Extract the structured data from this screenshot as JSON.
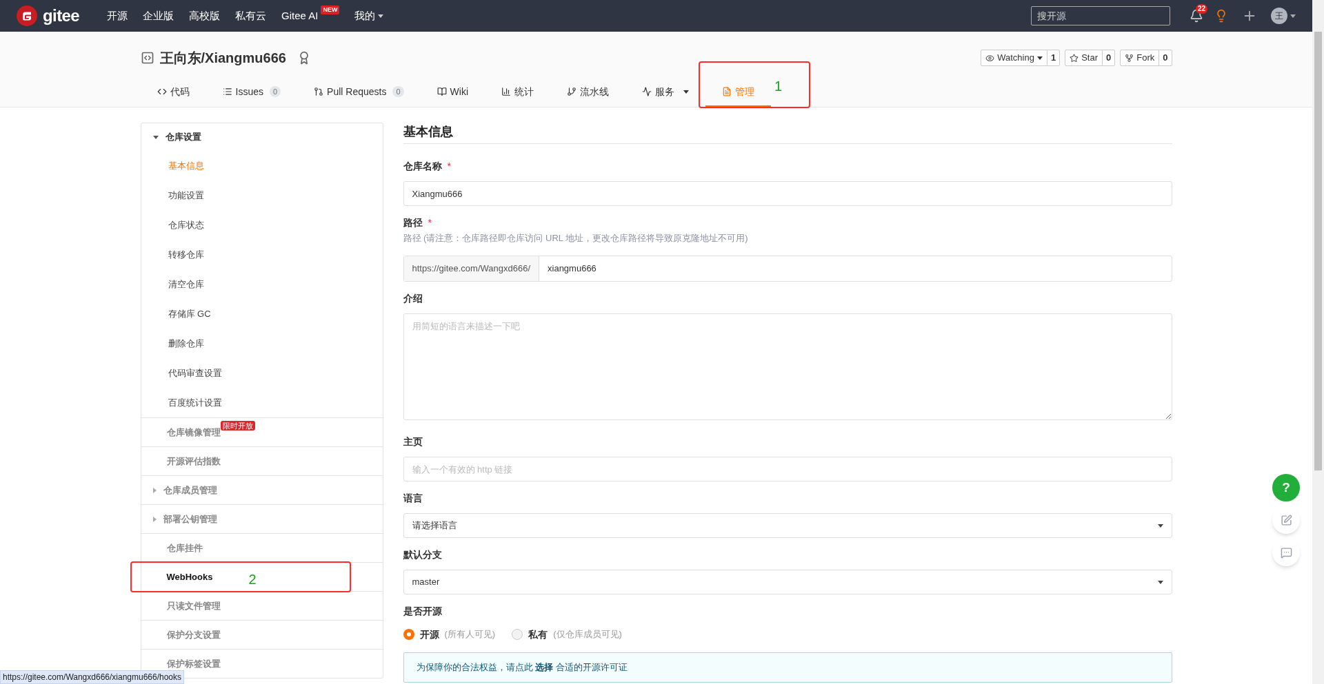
{
  "navbar": {
    "logo_text": "gitee",
    "items": [
      {
        "label": "开源"
      },
      {
        "label": "企业版"
      },
      {
        "label": "高校版"
      },
      {
        "label": "私有云"
      },
      {
        "label": "Gitee AI",
        "badge": "NEW"
      },
      {
        "label": "我的",
        "dropdown": true
      }
    ],
    "search": {
      "placeholder": "搜开源"
    },
    "notification_count": "22",
    "avatar_text": "王"
  },
  "repo": {
    "title": "王向东/Xiangmu666",
    "actions": [
      {
        "label": "Watching",
        "dropdown": true,
        "count": "1"
      },
      {
        "label": "Star",
        "dropdown": false,
        "count": "0"
      },
      {
        "label": "Fork",
        "dropdown": false,
        "count": "0"
      }
    ],
    "tabs": [
      {
        "label": "代码",
        "selected": false
      },
      {
        "label": "Issues",
        "count": "0",
        "selected": false
      },
      {
        "label": "Pull Requests",
        "count": "0",
        "selected": false
      },
      {
        "label": "Wiki",
        "selected": false
      },
      {
        "label": "统计",
        "selected": false
      },
      {
        "label": "流水线",
        "selected": false
      },
      {
        "label": "服务",
        "dropdown": true,
        "selected": false
      },
      {
        "label": "管理",
        "selected": true,
        "annotation": "1"
      }
    ]
  },
  "sidebar": {
    "items": [
      {
        "kind": "group",
        "label": "仓库设置",
        "expanded": true,
        "children": [
          {
            "label": "基本信息",
            "selected": true
          },
          {
            "label": "功能设置",
            "selected": false
          },
          {
            "label": "仓库状态",
            "selected": false
          },
          {
            "label": "转移仓库",
            "selected": false
          },
          {
            "label": "清空仓库",
            "selected": false
          },
          {
            "label": "存储库 GC",
            "selected": false
          },
          {
            "label": "删除仓库",
            "selected": false
          },
          {
            "label": "代码审查设置",
            "selected": false
          },
          {
            "label": "百度统计设置",
            "selected": false
          }
        ]
      },
      {
        "kind": "link",
        "label": "仓库镜像管理",
        "badge": "限时开放",
        "hovered": false
      },
      {
        "kind": "link",
        "label": "开源评估指数",
        "hovered": false
      },
      {
        "kind": "group",
        "label": "仓库成员管理",
        "expanded": false
      },
      {
        "kind": "group",
        "label": "部署公钥管理",
        "expanded": false
      },
      {
        "kind": "link",
        "label": "仓库挂件",
        "hovered": false
      },
      {
        "kind": "link",
        "label": "WebHooks",
        "hovered": true,
        "annotation": "2"
      },
      {
        "kind": "link",
        "label": "只读文件管理",
        "hovered": false
      },
      {
        "kind": "link",
        "label": "保护分支设置",
        "hovered": false
      },
      {
        "kind": "link",
        "label": "保护标签设置",
        "hovered": false
      }
    ]
  },
  "form": {
    "title": "基本信息",
    "fields": [
      {
        "kind": "text",
        "label": "仓库名称",
        "required_mark": "*",
        "value": "Xiangmu666"
      },
      {
        "kind": "path",
        "label": "路径",
        "required_mark": "*",
        "hint": "路径 (请注意：仓库路径即仓库访问 URL 地址，更改仓库路径将导致原克隆地址不可用)",
        "prefix": "https://gitee.com/Wangxd666/",
        "value": "xiangmu666"
      },
      {
        "kind": "textarea",
        "label": "介绍",
        "placeholder": "用简短的语言来描述一下吧"
      },
      {
        "kind": "text",
        "label": "主页",
        "placeholder": "输入一个有效的 http 链接"
      },
      {
        "kind": "select",
        "label": "语言",
        "value": "请选择语言"
      },
      {
        "kind": "select",
        "label": "默认分支",
        "value": "master"
      },
      {
        "kind": "radio",
        "label": "是否开源",
        "options": [
          {
            "label": "开源",
            "note": "(所有人可见)",
            "selected": true
          },
          {
            "label": "私有",
            "note": "(仅仓库成员可见)",
            "selected": false
          }
        ]
      }
    ],
    "notice": {
      "before": "为保障你的合法权益，请点此",
      "link": "选择",
      "after": "合适的开源许可证"
    }
  },
  "floating_buttons": {
    "help": "?"
  },
  "status_url": "https://gitee.com/Wangxd666/xiangmu666/hooks"
}
